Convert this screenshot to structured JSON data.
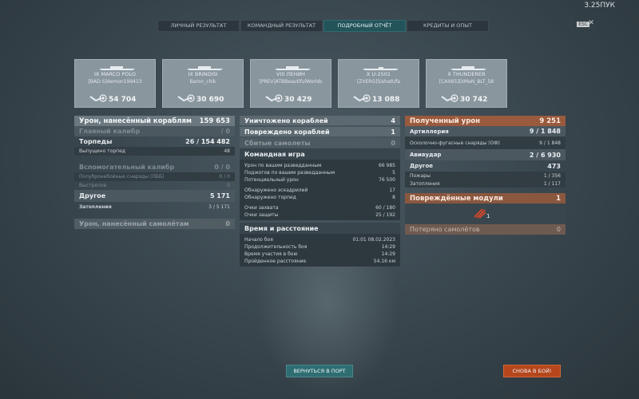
{
  "version": "3.25ПУК",
  "esc_label": "ESC",
  "close_label": "✕",
  "tabs": [
    {
      "label": "ЛИЧНЫЙ РЕЗУЛЬТАТ",
      "active": false
    },
    {
      "label": "КОМАНДНЫЙ РЕЗУЛЬТАТ",
      "active": false
    },
    {
      "label": "ПОДРОБНЫЙ ОТЧЁТ",
      "active": true
    },
    {
      "label": "КРЕДИТЫ И ОПЫТ",
      "active": false
    }
  ],
  "ships": [
    {
      "name": "IX MARCO POLO",
      "player": "[BAD-S]demon199413",
      "score": "54 704"
    },
    {
      "name": "IX BRINDISI",
      "player": "Baron_chik",
      "score": "30 690"
    },
    {
      "name": "VIII ЛЕНИН",
      "player": "[PREV]ATBBeautifulWorlds",
      "score": "30 429"
    },
    {
      "name": "X U-2501",
      "player": "[ZVERG]SishatUfa",
      "score": "13 088"
    },
    {
      "name": "X THUNDERER",
      "player": "[CAX65]DiMaN_BLT_58",
      "score": "30 742"
    }
  ],
  "left": {
    "damage_header": {
      "label": "Урон, нанесённый кораблям",
      "value": "159 653"
    },
    "main_caliber": {
      "label": "Главный калибр",
      "value": "/ 0"
    },
    "torpedoes": {
      "label": "Торпеды",
      "value_a": "26",
      "value_b": "154 482"
    },
    "torpedoes_fired": {
      "label": "Выпущено торпед",
      "value": "48"
    },
    "secondary": {
      "label": "Вспомогательный калибр",
      "value": "0 / 0"
    },
    "ap_shells": {
      "label": "Полубронебойные снаряды (ПББ)",
      "value": "0 / 0"
    },
    "shots": {
      "label": "Выстрелов",
      "value": "0"
    },
    "other": {
      "label": "Другое",
      "value": "5 171"
    },
    "flooding": {
      "label": "Затопления",
      "value_a": "3",
      "value_b": "5 171"
    },
    "aircraft_damage": {
      "label": "Урон, нанесённый самолётам",
      "value": "0"
    }
  },
  "center": {
    "destroyed": {
      "label": "Уничтожено кораблей",
      "value": "4"
    },
    "damaged": {
      "label": "Повреждено кораблей",
      "value": "1"
    },
    "planes_shot": {
      "label": "Сбитые самолеты",
      "value": "0"
    },
    "team_header": "Командная игра",
    "team_rows": [
      {
        "label": "Урон по вашим разведданным",
        "value": "66 985"
      },
      {
        "label": "Поджогов по вашим разведданным",
        "value": "5"
      },
      {
        "label": "Потенциальный урон",
        "value": "76 500"
      },
      {
        "label": "Обнаружено эскадрилий",
        "value": "17"
      },
      {
        "label": "Обнаружено торпед",
        "value": "8"
      },
      {
        "label": "Очки захвата",
        "value": "60 / 180"
      },
      {
        "label": "Очки защиты",
        "value": "25 / 192"
      }
    ],
    "time_header": "Время и расстояние",
    "time_rows": [
      {
        "label": "Начало боя",
        "value": "01:01   08.02.2023"
      },
      {
        "label": "Продолжительность боя",
        "value": "14:29"
      },
      {
        "label": "Время участия в бою",
        "value": "14:29"
      },
      {
        "label": "Пройденное расстояние",
        "value": "54.16 км"
      }
    ]
  },
  "right": {
    "received_header": {
      "label": "Полученный урон",
      "value": "9 251"
    },
    "artillery": {
      "label": "Артиллерия",
      "value_a": "9",
      "value_b": "1 848"
    },
    "he_shells": {
      "label": "Осколочно-фугасные снаряды (ОФ)",
      "value_a": "9",
      "value_b": "1 848"
    },
    "air_strike": {
      "label": "Авиаудар",
      "value_a": "2",
      "value_b": "6 930"
    },
    "other": {
      "label": "Другое",
      "value": "473"
    },
    "fires": {
      "label": "Пожары",
      "value_a": "1",
      "value_b": "356"
    },
    "floods": {
      "label": "Затопления",
      "value_a": "1",
      "value_b": "117"
    },
    "modules_header": {
      "label": "Повреждённые модули",
      "value": "1"
    },
    "module_count": "1",
    "planes_lost": {
      "label": "Потеряно самолётов",
      "value": "0"
    }
  },
  "buttons": {
    "port": "ВЕРНУТЬСЯ В ПОРТ",
    "battle": "СНОВА В БОЙ!"
  },
  "colors": {
    "accent_teal": "#23545a",
    "accent_orange": "#b6461c"
  }
}
